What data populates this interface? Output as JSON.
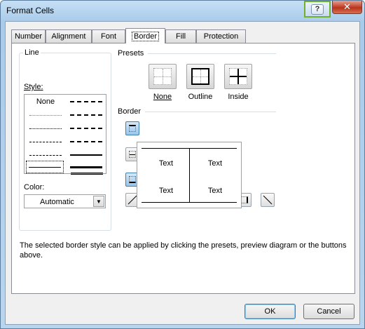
{
  "window": {
    "title": "Format Cells",
    "help_glyph": "?",
    "close_glyph": "✕"
  },
  "tabs": [
    {
      "label": "Number"
    },
    {
      "label": "Alignment"
    },
    {
      "label": "Font"
    },
    {
      "label": "Border",
      "active": true
    },
    {
      "label": "Fill"
    },
    {
      "label": "Protection"
    }
  ],
  "line": {
    "group_title": "Line",
    "style_label": "Style:",
    "none_label": "None",
    "color_label": "Color:",
    "color_value": "Automatic"
  },
  "presets": {
    "group_title": "Presets",
    "items": [
      {
        "label": "None",
        "icon": "preset-none-icon"
      },
      {
        "label": "Outline",
        "icon": "preset-outline-icon"
      },
      {
        "label": "Inside",
        "icon": "preset-inside-icon"
      }
    ]
  },
  "border": {
    "group_title": "Border",
    "preview_cells": [
      "Text",
      "Text",
      "Text",
      "Text"
    ]
  },
  "info_text": "The selected border style can be applied by clicking the presets, preview diagram or the buttons above.",
  "buttons": {
    "ok": "OK",
    "cancel": "Cancel"
  },
  "colors": {
    "accent": "#3c7fb1",
    "help_highlight": "#6fb12a",
    "close_red": "#c44a32"
  }
}
